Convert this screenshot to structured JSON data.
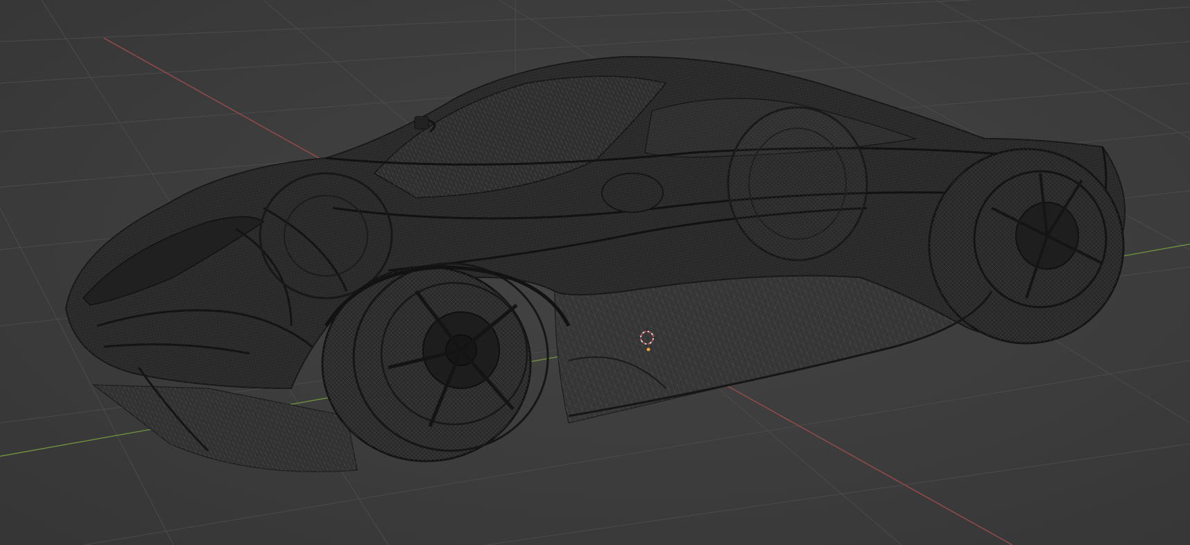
{
  "viewport": {
    "background_color": "#3d3d3d",
    "grid_color": "#4a4a4a",
    "x_axis_color": "#9a4b4b",
    "y_axis_color": "#6f8f3e",
    "wire_color": "#151515",
    "body_fill": "#262626",
    "shading": "wireframe",
    "object": "sports-car-mesh"
  },
  "cursor_3d": {
    "ring_colors": [
      "#d9d9d9",
      "#c94a4a"
    ],
    "origin_color": "#f0a030"
  }
}
